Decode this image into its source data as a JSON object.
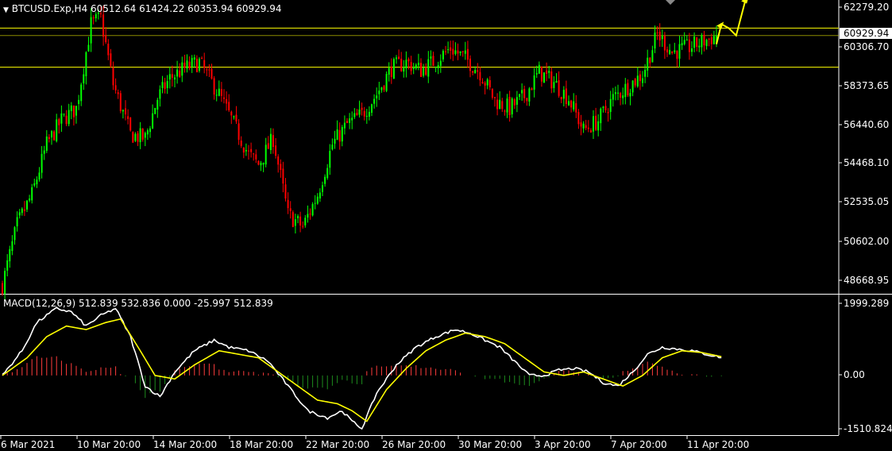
{
  "header": {
    "symbol_line": "BTCUSD.Exp,H4  60512.64 61424.22 60353.94 60929.94",
    "macd_line": "MACD(12,26,9) 512.839 532.836 0.000 -25.997 512.839"
  },
  "colors": {
    "background": "#000000",
    "bull": "#00ff00",
    "bear": "#ff0000",
    "grid_frame": "#ffffff",
    "level_line": "#ffff00",
    "macd_line": "#ffffff",
    "signal_line": "#ffff00",
    "hist_pos": "#ff3c3c",
    "hist_neg": "#1e8c1e",
    "arrow": "#ffff00"
  },
  "chart_data": [
    {
      "type": "candlestick",
      "symbol": "BTCUSD.Exp",
      "timeframe": "H4",
      "ohlc_last": {
        "open": 60512.64,
        "high": 61424.22,
        "low": 60353.94,
        "close": 60929.94
      },
      "current_price_label": "60929.94",
      "y_ticks": [
        "62279.20",
        "60306.70",
        "58373.65",
        "56440.60",
        "54468.10",
        "52535.05",
        "50602.00",
        "48668.95"
      ],
      "x_ticks": [
        "6 Mar 2021",
        "10 Mar 20:00",
        "14 Mar 20:00",
        "18 Mar 20:00",
        "22 Mar 20:00",
        "26 Mar 20:00",
        "30 Mar 20:00",
        "3 Apr 20:00",
        "7 Apr 20:00",
        "11 Apr 20:00"
      ],
      "ylim": [
        48100,
        62700
      ],
      "horizontal_levels": [
        61300,
        60930,
        59350
      ],
      "close_anchors": [
        [
          0,
          48500
        ],
        [
          6,
          51500
        ],
        [
          12,
          53000
        ],
        [
          18,
          55500
        ],
        [
          24,
          56700
        ],
        [
          30,
          57300
        ],
        [
          36,
          61500
        ],
        [
          40,
          61800
        ],
        [
          45,
          58500
        ],
        [
          52,
          56000
        ],
        [
          58,
          55800
        ],
        [
          63,
          57800
        ],
        [
          68,
          58800
        ],
        [
          74,
          59300
        ],
        [
          80,
          59600
        ],
        [
          88,
          58000
        ],
        [
          94,
          56500
        ],
        [
          100,
          55000
        ],
        [
          104,
          54500
        ],
        [
          110,
          55800
        ],
        [
          116,
          52000
        ],
        [
          122,
          51400
        ],
        [
          128,
          53000
        ],
        [
          134,
          55500
        ],
        [
          140,
          56500
        ],
        [
          146,
          57000
        ],
        [
          152,
          58000
        ],
        [
          158,
          59300
        ],
        [
          164,
          59600
        ],
        [
          170,
          59200
        ],
        [
          176,
          59700
        ],
        [
          182,
          60300
        ],
        [
          188,
          59800
        ],
        [
          194,
          59100
        ],
        [
          200,
          57700
        ],
        [
          206,
          57300
        ],
        [
          212,
          57900
        ],
        [
          218,
          59100
        ],
        [
          224,
          58600
        ],
        [
          230,
          57800
        ],
        [
          236,
          56200
        ],
        [
          242,
          56700
        ],
        [
          248,
          57800
        ],
        [
          254,
          58400
        ],
        [
          260,
          59000
        ],
        [
          266,
          61000
        ],
        [
          272,
          60100
        ],
        [
          278,
          60300
        ],
        [
          284,
          60600
        ],
        [
          290,
          60930
        ]
      ],
      "forecast_path": [
        [
          290,
          60500
        ],
        [
          292,
          61500
        ],
        [
          295,
          61300
        ],
        [
          298,
          60930
        ],
        [
          302,
          62800
        ]
      ]
    },
    {
      "type": "macd",
      "params": "12,26,9",
      "values": {
        "macd": 512.839,
        "signal": 532.836
      },
      "y_ticks": [
        "1999.289",
        "0.00",
        "-1510.824"
      ],
      "ylim": [
        -1510.824,
        1999.289
      ],
      "macd_anchors": [
        [
          0,
          0
        ],
        [
          8,
          700
        ],
        [
          14,
          1500
        ],
        [
          22,
          1900
        ],
        [
          28,
          1800
        ],
        [
          34,
          1400
        ],
        [
          40,
          1700
        ],
        [
          46,
          1900
        ],
        [
          52,
          1100
        ],
        [
          58,
          -300
        ],
        [
          64,
          -600
        ],
        [
          70,
          100
        ],
        [
          78,
          700
        ],
        [
          86,
          1000
        ],
        [
          92,
          800
        ],
        [
          100,
          700
        ],
        [
          108,
          400
        ],
        [
          116,
          -300
        ],
        [
          124,
          -1000
        ],
        [
          132,
          -1200
        ],
        [
          138,
          -1000
        ],
        [
          142,
          -1300
        ],
        [
          146,
          -1500
        ],
        [
          152,
          -500
        ],
        [
          160,
          300
        ],
        [
          168,
          800
        ],
        [
          176,
          1100
        ],
        [
          184,
          1300
        ],
        [
          190,
          1200
        ],
        [
          196,
          1000
        ],
        [
          202,
          800
        ],
        [
          208,
          400
        ],
        [
          214,
          0
        ],
        [
          220,
          0
        ],
        [
          226,
          150
        ],
        [
          232,
          200
        ],
        [
          238,
          100
        ],
        [
          244,
          -200
        ],
        [
          250,
          -300
        ],
        [
          256,
          100
        ],
        [
          262,
          600
        ],
        [
          268,
          800
        ],
        [
          274,
          750
        ],
        [
          280,
          700
        ],
        [
          286,
          600
        ],
        [
          292,
          512
        ]
      ],
      "signal_anchors": [
        [
          0,
          0
        ],
        [
          10,
          500
        ],
        [
          18,
          1100
        ],
        [
          26,
          1400
        ],
        [
          34,
          1300
        ],
        [
          42,
          1500
        ],
        [
          48,
          1600
        ],
        [
          56,
          700
        ],
        [
          62,
          0
        ],
        [
          70,
          -100
        ],
        [
          78,
          300
        ],
        [
          88,
          700
        ],
        [
          96,
          600
        ],
        [
          104,
          500
        ],
        [
          112,
          100
        ],
        [
          120,
          -300
        ],
        [
          128,
          -700
        ],
        [
          136,
          -800
        ],
        [
          142,
          -1000
        ],
        [
          148,
          -1300
        ],
        [
          156,
          -400
        ],
        [
          164,
          200
        ],
        [
          172,
          700
        ],
        [
          180,
          1000
        ],
        [
          188,
          1200
        ],
        [
          196,
          1100
        ],
        [
          204,
          900
        ],
        [
          212,
          500
        ],
        [
          220,
          100
        ],
        [
          228,
          0
        ],
        [
          236,
          100
        ],
        [
          244,
          -100
        ],
        [
          252,
          -300
        ],
        [
          260,
          0
        ],
        [
          268,
          500
        ],
        [
          276,
          700
        ],
        [
          284,
          650
        ],
        [
          292,
          533
        ]
      ]
    }
  ]
}
